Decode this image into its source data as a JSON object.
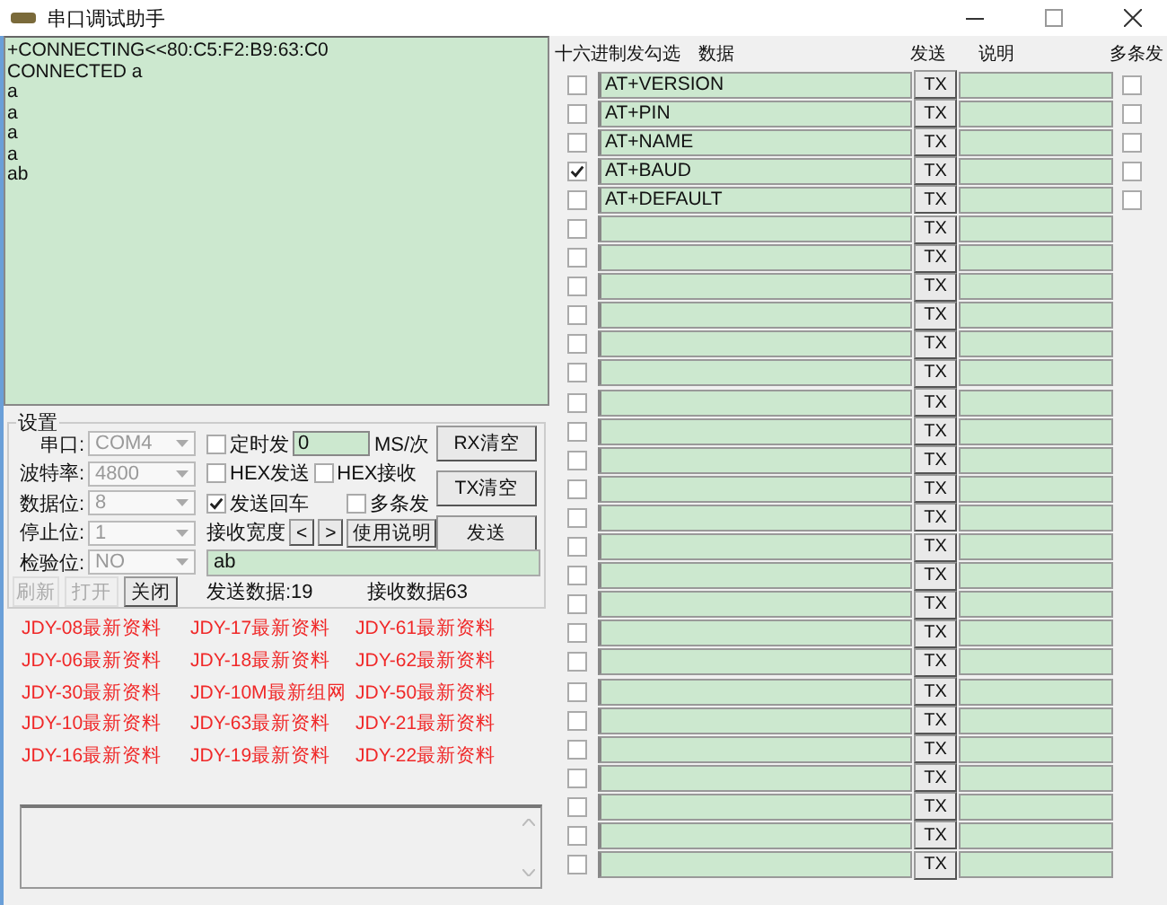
{
  "window": {
    "title": "串口调试助手"
  },
  "receive": {
    "lines": [
      "+CONNECTING<<80:C5:F2:B9:63:C0",
      "CONNECTED a",
      "a",
      "a",
      "a",
      "a",
      "ab"
    ]
  },
  "settings": {
    "title": "设置",
    "ports": [
      {
        "label": "串口:",
        "value": "COM4",
        "disabled": true
      },
      {
        "label": "波特率:",
        "value": "4800",
        "disabled": true
      },
      {
        "label": "数据位:",
        "value": "8",
        "disabled": true
      },
      {
        "label": "停止位:",
        "value": "1",
        "disabled": true
      },
      {
        "label": "检验位:",
        "value": "NO",
        "disabled": true
      }
    ],
    "timed_send": {
      "label": "定时发",
      "checked": false,
      "value": "0",
      "unit": "MS/次"
    },
    "hex_send": {
      "label": "HEX发送",
      "checked": false
    },
    "hex_receive": {
      "label": "HEX接收",
      "checked": false
    },
    "send_newline": {
      "label": "发送回车",
      "checked": true
    },
    "multi_send": {
      "label": "多条发",
      "checked": false
    },
    "receive_width": {
      "label": "接收宽度",
      "prev": "<",
      "next": ">"
    },
    "help_button": "使用说明",
    "rx_clear": "RX清空",
    "tx_clear": "TX清空",
    "send_button": "发送",
    "send_field": {
      "value": "ab"
    },
    "port_buttons": [
      {
        "label": "刷新",
        "disabled": true
      },
      {
        "label": "打开",
        "disabled": true
      },
      {
        "label": "关闭",
        "disabled": false
      }
    ],
    "sent_count": "发送数据:19",
    "received_count": "接收数据63"
  },
  "links": [
    "JDY-08最新资料",
    "JDY-17最新资料",
    "JDY-61最新资料",
    "JDY-06最新资料",
    "JDY-18最新资料",
    "JDY-62最新资料",
    "JDY-30最新资料",
    "JDY-10M最新组网",
    "JDY-50最新资料",
    "JDY-10最新资料",
    "JDY-63最新资料",
    "JDY-21最新资料",
    "JDY-16最新资料",
    "JDY-19最新资料",
    "JDY-22最新资料"
  ],
  "commands": {
    "columns": [
      "十六进制发勾选",
      "数据",
      "发送",
      "说明",
      "多条发"
    ],
    "rows": [
      {
        "hex": false,
        "data": "AT+VERSION",
        "button": "TX",
        "multi": false
      },
      {
        "hex": false,
        "data": "AT+PIN",
        "button": "TX",
        "multi": false
      },
      {
        "hex": false,
        "data": "AT+NAME",
        "button": "TX",
        "multi": false
      },
      {
        "hex": true,
        "data": "AT+BAUD",
        "button": "TX",
        "multi": false
      },
      {
        "hex": false,
        "data": "AT+DEFAULT",
        "button": "TX",
        "multi": false
      },
      {
        "hex": false,
        "button": "TX"
      },
      {
        "hex": false,
        "button": "TX"
      },
      {
        "hex": false,
        "button": "TX"
      },
      {
        "hex": false,
        "button": "TX"
      },
      {
        "hex": false,
        "button": "TX"
      },
      {
        "hex": false,
        "button": "TX"
      },
      {
        "hex": false,
        "button": "TX"
      },
      {
        "hex": false,
        "button": "TX"
      },
      {
        "hex": false,
        "button": "TX"
      },
      {
        "hex": false,
        "button": "TX"
      },
      {
        "hex": false,
        "button": "TX"
      },
      {
        "hex": false,
        "button": "TX"
      },
      {
        "hex": false,
        "button": "TX"
      },
      {
        "hex": false,
        "button": "TX"
      },
      {
        "hex": false,
        "button": "TX"
      },
      {
        "hex": false,
        "button": "TX"
      },
      {
        "hex": false,
        "button": "TX"
      },
      {
        "hex": false,
        "button": "TX"
      },
      {
        "hex": false,
        "button": "TX"
      },
      {
        "hex": false,
        "button": "TX"
      },
      {
        "hex": false,
        "button": "TX"
      },
      {
        "hex": false,
        "button": "TX"
      },
      {
        "hex": false,
        "button": "TX"
      }
    ]
  }
}
